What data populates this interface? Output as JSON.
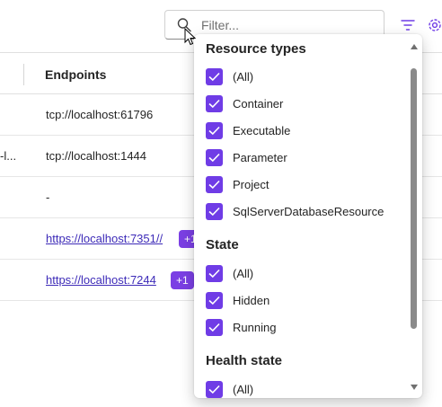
{
  "toolbar": {
    "filter_placeholder": "Filter...",
    "filter_icon": "funnel-icon",
    "settings_icon": "gear-icon",
    "accent_color": "#6f3ce6"
  },
  "table": {
    "header": {
      "endpoints": "Endpoints"
    },
    "rows": [
      {
        "prefix": "",
        "endpoint": "tcp://localhost:61796",
        "is_link": false,
        "badge": ""
      },
      {
        "prefix": "-l...",
        "endpoint": "tcp://localhost:1444",
        "is_link": false,
        "badge": ""
      },
      {
        "prefix": "",
        "endpoint": "-",
        "is_link": false,
        "badge": ""
      },
      {
        "prefix": "",
        "endpoint": "https://localhost:7351//",
        "is_link": true,
        "badge": "+1"
      },
      {
        "prefix": "",
        "endpoint": "https://localhost:7244",
        "is_link": true,
        "badge": "+1"
      }
    ]
  },
  "dropdown": {
    "groups": [
      {
        "title": "Resource types",
        "options": [
          {
            "label": "(All)",
            "checked": true
          },
          {
            "label": "Container",
            "checked": true
          },
          {
            "label": "Executable",
            "checked": true
          },
          {
            "label": "Parameter",
            "checked": true
          },
          {
            "label": "Project",
            "checked": true
          },
          {
            "label": "SqlServerDatabaseResource",
            "checked": true
          }
        ]
      },
      {
        "title": "State",
        "options": [
          {
            "label": "(All)",
            "checked": true
          },
          {
            "label": "Hidden",
            "checked": true
          },
          {
            "label": "Running",
            "checked": true
          }
        ]
      },
      {
        "title": "Health state",
        "options": [
          {
            "label": "(All)",
            "checked": true
          }
        ]
      }
    ]
  }
}
